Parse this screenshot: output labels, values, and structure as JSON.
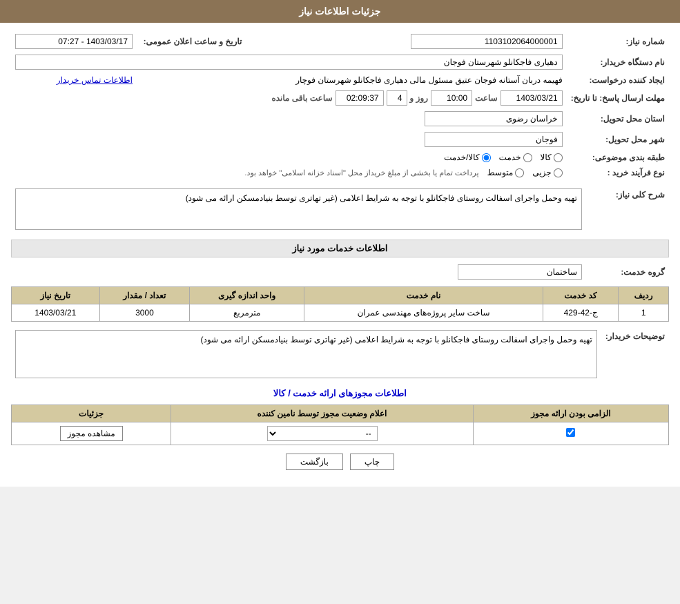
{
  "page": {
    "title": "جزئیات اطلاعات نیاز"
  },
  "header": {
    "title": "جزئیات اطلاعات نیاز"
  },
  "fields": {
    "need_number_label": "شماره نیاز:",
    "need_number_value": "1103102064000001",
    "buyer_org_label": "نام دستگاه خریدار:",
    "buyer_org_value": "دهیاری فاجکانلو شهرستان فوجان",
    "creator_label": "ایجاد کننده درخواست:",
    "creator_value": "فهیمه دربان آستانه فوجان عتیق مسئول مالی دهیاری فاجکانلو شهرستان فوچار",
    "creator_link": "اطلاعات تماس خریدار",
    "deadline_label": "مهلت ارسال پاسخ: تا تاریخ:",
    "deadline_date": "1403/03/21",
    "deadline_time_label": "ساعت",
    "deadline_time": "10:00",
    "deadline_days_label": "روز و",
    "deadline_days": "4",
    "deadline_remaining_label": "ساعت باقی مانده",
    "deadline_remaining": "02:09:37",
    "announce_label": "تاریخ و ساعت اعلان عمومی:",
    "announce_value": "1403/03/17 - 07:27",
    "province_label": "استان محل تحویل:",
    "province_value": "خراسان رضوی",
    "city_label": "شهر محل تحویل:",
    "city_value": "فوجان",
    "category_label": "طبقه بندی موضوعی:",
    "category_goods": "کالا",
    "category_service": "خدمت",
    "category_goods_service": "کالا/خدمت",
    "process_label": "نوع فرآیند خرید :",
    "process_partial": "جزیی",
    "process_medium": "متوسط",
    "process_note": "پرداخت تمام یا بخشی از مبلغ خریداز محل \"اسناد خزانه اسلامی\" خواهد بود.",
    "description_label": "شرح کلی نیاز:",
    "description_value": "تهیه وحمل واجرای اسفالت روستای فاجکانلو با توجه به شرایط اعلامی (غیر تهاتری توسط بنیادمسکن ارائه می شود)"
  },
  "services_section": {
    "title": "اطلاعات خدمات مورد نیاز",
    "group_label": "گروه خدمت:",
    "group_value": "ساختمان",
    "table_headers": [
      "ردیف",
      "کد خدمت",
      "نام خدمت",
      "واحد اندازه گیری",
      "تعداد / مقدار",
      "تاریخ نیاز"
    ],
    "rows": [
      {
        "row": "1",
        "code": "ج-42-429",
        "name": "ساخت سایر پروژه‌های مهندسی عمران",
        "unit": "مترمربع",
        "quantity": "3000",
        "date": "1403/03/21"
      }
    ],
    "buyer_notes_label": "توضیحات خریدار:",
    "buyer_notes_value": "تهیه وحمل واجرای اسفالت روستای فاجکانلو با توجه به شرایط اعلامی (غیر تهاتری توسط بنیادمسکن ارائه می شود)"
  },
  "permissions_section": {
    "title": "اطلاعات مجوزهای ارائه خدمت / کالا",
    "table_headers": [
      "الزامی بودن ارائه مجوز",
      "اعلام وضعیت مجوز توسط نامین کننده",
      "جزئیات"
    ],
    "rows": [
      {
        "required": true,
        "status": "--",
        "details_btn": "مشاهده مجوز"
      }
    ]
  },
  "buttons": {
    "print": "چاپ",
    "back": "بازگشت"
  }
}
